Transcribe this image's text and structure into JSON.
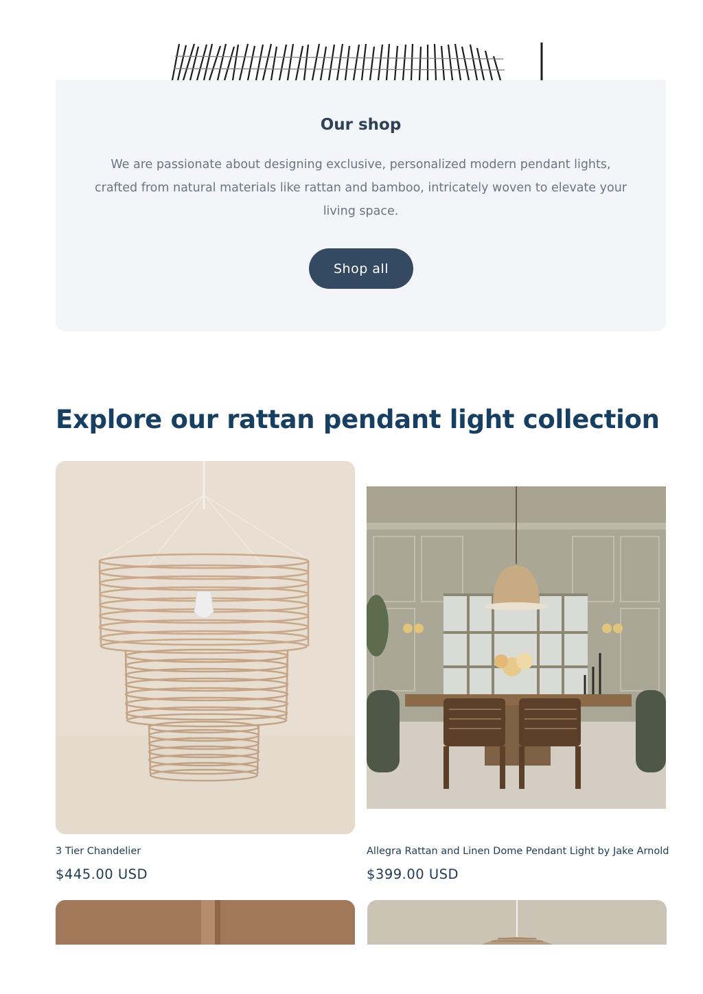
{
  "shop": {
    "title": "Our shop",
    "description": "We are passionate about designing exclusive, personalized modern pendant lights, crafted from natural materials like rattan and bamboo, intricately woven to elevate your living space.",
    "button_label": "Shop all"
  },
  "collection": {
    "title": "Explore our rattan pendant light collection",
    "products": [
      {
        "name": "3 Tier Chandelier",
        "price": "$445.00 USD"
      },
      {
        "name": "Allegra Rattan and Linen Dome Pendant Light by Jake Arnold",
        "price": "$399.00 USD"
      }
    ]
  },
  "colors": {
    "card_background": "#f3f5f9",
    "button_background": "#344a63",
    "heading": "#173f61",
    "body_text": "#6a7482"
  }
}
